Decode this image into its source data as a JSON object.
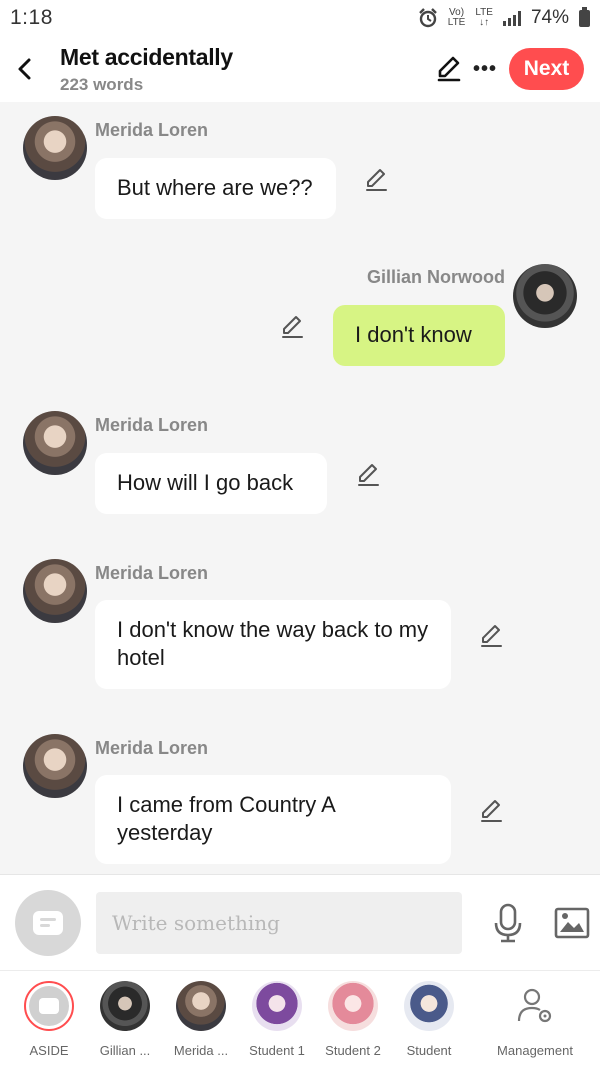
{
  "status_bar": {
    "time": "1:18",
    "network_small_1": "Vo)\nLTE",
    "network_small_2": "LTE",
    "battery_percent": "74%"
  },
  "header": {
    "title": "Met accidentally",
    "word_count": "223 words",
    "next_label": "Next"
  },
  "messages": [
    {
      "sender": "Merida Loren",
      "text": "But where are we??",
      "side": "left"
    },
    {
      "sender": "Gillian Norwood",
      "text": "I don't  know",
      "side": "right"
    },
    {
      "sender": "Merida Loren",
      "text": "How will I go back",
      "side": "left"
    },
    {
      "sender": "Merida Loren",
      "text": "I don't know the way back to my hotel",
      "side": "left"
    },
    {
      "sender": "Merida Loren",
      "text": "I came from Country A yesterday",
      "side": "left"
    }
  ],
  "input": {
    "placeholder": "Write something"
  },
  "characters": [
    {
      "label": "ASIDE"
    },
    {
      "label": "Gillian ..."
    },
    {
      "label": "Merida ..."
    },
    {
      "label": "Student 1"
    },
    {
      "label": "Student 2"
    },
    {
      "label": "Student"
    },
    {
      "label": "Management"
    }
  ],
  "colors": {
    "accent": "#ff4d4f",
    "my_bubble": "#d7f484",
    "other_bubble": "#ffffff",
    "background": "#f5f5f5"
  },
  "icons": {
    "back": "chevron-left-icon",
    "edit": "pencil-icon",
    "more": "more-dots-icon",
    "mic": "microphone-icon",
    "image": "image-icon",
    "management": "user-settings-icon"
  }
}
